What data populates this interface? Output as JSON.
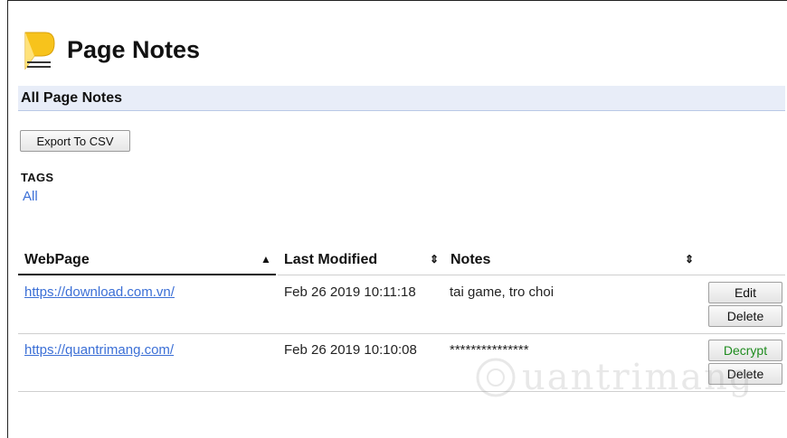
{
  "header": {
    "title": "Page Notes"
  },
  "section": {
    "title": "All Page Notes"
  },
  "toolbar": {
    "export_label": "Export To CSV"
  },
  "tags": {
    "label": "TAGS",
    "items": [
      "All"
    ]
  },
  "table": {
    "columns": [
      {
        "label": "WebPage",
        "sort_icon": "▲"
      },
      {
        "label": "Last Modified",
        "sort_icon": "⇕"
      },
      {
        "label": "Notes",
        "sort_icon": "⇕"
      }
    ],
    "rows": [
      {
        "url": "https://download.com.vn/",
        "modified": "Feb 26 2019 10:11:18",
        "notes": "tai game, tro choi",
        "action_primary": "Edit",
        "action_secondary": "Delete"
      },
      {
        "url": "https://quantrimang.com/",
        "modified": "Feb 26 2019 10:10:08",
        "notes": "***************",
        "action_primary": "Decrypt",
        "action_secondary": "Delete"
      }
    ]
  },
  "watermark": {
    "text": "uantrimang"
  },
  "colors": {
    "link": "#3b6fd6",
    "section_bg": "#e8edf8",
    "decrypt": "#1f8c1f"
  }
}
